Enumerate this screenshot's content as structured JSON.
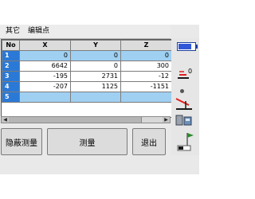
{
  "menu": {
    "items": [
      {
        "label": "其它"
      },
      {
        "label": "编辑点"
      }
    ]
  },
  "table": {
    "headers": [
      "No",
      "X",
      "Y",
      "Z"
    ],
    "rows": [
      {
        "no": "1",
        "x": "0",
        "y": "0",
        "z": "0",
        "selected": true
      },
      {
        "no": "2",
        "x": "6642",
        "y": "0",
        "z": "300",
        "selected": false
      },
      {
        "no": "3",
        "x": "-195",
        "y": "2731",
        "z": "-12",
        "selected": false
      },
      {
        "no": "4",
        "x": "-207",
        "y": "1125",
        "z": "-1151",
        "selected": false
      },
      {
        "no": "5",
        "x": "",
        "y": "",
        "z": "",
        "selected": true
      }
    ]
  },
  "status": {
    "prism_offset": "0",
    "battery_level": 0.9
  },
  "buttons": {
    "hidden_measure": "隐蔽测量",
    "measure": "测量",
    "exit": "退出"
  },
  "icons": {
    "battery": "battery-icon",
    "prism": "prism-icon",
    "tilt": "tilt-icon",
    "device": "device-icon",
    "flag": "flag-icon"
  },
  "colors": {
    "index_column": "#2b79d6",
    "selected_row": "#9fd0f2"
  }
}
